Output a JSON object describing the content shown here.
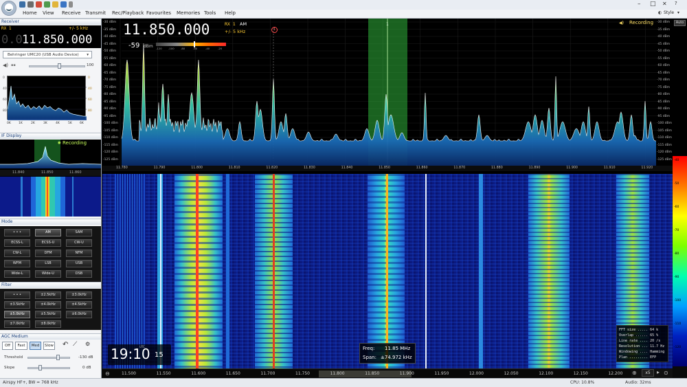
{
  "menu": [
    "Home",
    "View",
    "Receive",
    "Transmit",
    "Rec/Playback",
    "Favourites",
    "Memories",
    "Tools",
    "Help"
  ],
  "style_label": "Style",
  "receiver": {
    "section_title": "Receiver",
    "rx_label": "RX 1",
    "bandwidth": "+/- 5 kHz",
    "freq_dim": "0.0",
    "freq_main": "11.850.000",
    "device": "Behringer UMC20 (USB Audio Device)",
    "volume": "100"
  },
  "mini_spectrum": {
    "y_ticks_left": [
      "0",
      "40",
      "60",
      "80"
    ],
    "y_ticks_right": [
      "0",
      "40",
      "60",
      "80"
    ],
    "x_ticks": [
      "0K",
      "1K",
      "2K",
      "3K",
      "4K",
      "5K",
      "6K"
    ]
  },
  "if_display": {
    "section_title": "IF Display",
    "recording": "Recording",
    "ticks": [
      "11.840",
      "11.850",
      "11.860"
    ]
  },
  "mode": {
    "section_title": "Mode",
    "buttons": [
      "• • •",
      "AM",
      "SAM",
      "ECSS-L",
      "ECSS-U",
      "CW-U",
      "CW-L",
      "DFM",
      "NFM",
      "WFM",
      "LSB",
      "USB",
      "Wide-L",
      "Wide-U",
      "DSB"
    ],
    "active": "AM"
  },
  "filter": {
    "section_title": "Filter",
    "buttons": [
      "• • •",
      "±2.5kHz",
      "±3.0kHz",
      "±3.5kHz",
      "±4.0kHz",
      "±4.5kHz",
      "±5.0kHz",
      "±5.5kHz",
      "±6.0kHz",
      "±7.0kHz",
      "±8.0kHz"
    ],
    "active": "±5.0kHz"
  },
  "agc": {
    "section_title": "AGC Medium",
    "buttons": [
      "Off",
      "Fast",
      "Med",
      "Slow"
    ],
    "active": "Med",
    "threshold_label": "Threshold",
    "threshold_value": "-130 dB",
    "slope_label": "Slope",
    "slope_value": "0 dB"
  },
  "main_display": {
    "freq": "11.850.000",
    "rx_label": "RX 1",
    "mode": "AM",
    "bandwidth": "+/- 5 kHz",
    "signal_level": "-59",
    "signal_unit": "dBm",
    "smeter_scale": [
      "-120",
      "-100",
      "-80",
      "-60",
      "-40",
      "-20"
    ],
    "recording": "Recording",
    "marker_number": "1",
    "channel_marker": "1",
    "auto_label": "Auto",
    "db_scale": [
      "-30 dBm",
      "-35 dBm",
      "-40 dBm",
      "-45 dBm",
      "-50 dBm",
      "-55 dBm",
      "-60 dBm",
      "-65 dBm",
      "-70 dBm",
      "-75 dBm",
      "-80 dBm",
      "-85 dBm",
      "-90 dBm",
      "-95 dBm",
      "-100 dBm",
      "-105 dBm",
      "-110 dBm",
      "-115 dBm",
      "-120 dBm",
      "-125 dBm"
    ],
    "db_scale_right": [
      "-30 dBm",
      "-35 dBm",
      "-40 dBm",
      "-45 dBm",
      "-50 dBm",
      "-55 dBm",
      "-60 dBm",
      "-65 dBm",
      "-70 dBm",
      "-75 dBm",
      "-80 dBm",
      "-85 dBm",
      "-90 dBm",
      "-95 dBm",
      "-100 dBm",
      "-105 dBm",
      "-110 dBm",
      "-115 dBm",
      "-120 dBm",
      "-125 dBm"
    ],
    "freq_ticks_top": [
      "11.780",
      "11.790",
      "11.800",
      "11.810",
      "11.820",
      "11.830",
      "11.840",
      "11.850",
      "11.860",
      "11.870",
      "11.880",
      "11.890",
      "11.900",
      "11.910",
      "11.920"
    ],
    "colorbar_ticks": [
      "-40",
      "-50",
      "-60",
      "-70",
      "-80",
      "-90",
      "-100",
      "-110",
      "-120"
    ]
  },
  "clock": {
    "time": "19:10",
    "seconds": "15",
    "label": "UTC"
  },
  "freq_span": {
    "freq_label": "Freq:",
    "freq_value": "11.85 MHz",
    "span_label": "Span:",
    "span_value": "±74.972 kHz"
  },
  "fft_info": [
    "FFT size ..... 64 k",
    "Overlap ...... 65 %",
    "Line rate .... 20 /s",
    "Resolution ... 11.7 Hz",
    "Windowing .... Hamming",
    "Plan ......... EFP"
  ],
  "bottom_axis": [
    "11.500",
    "11.550",
    "11.600",
    "11.650",
    "11.700",
    "11.750",
    "11.800",
    "11.850",
    "11.900",
    "11.950",
    "12.000",
    "12.050",
    "12.100",
    "12.150",
    "12.200"
  ],
  "zoom": "x5",
  "status": {
    "left": "Airspy HF+, BW = 768 kHz",
    "cpu": "CPU: 10.8%",
    "audio": "Audio: 32ms"
  }
}
